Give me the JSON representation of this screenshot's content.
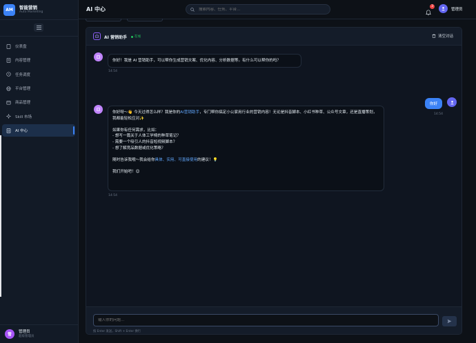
{
  "brand": {
    "logo": "AM",
    "name": "智能营销",
    "subtitle": "Auto Marketing"
  },
  "sidebar": {
    "items": [
      {
        "label": "仪表盘",
        "icon": "file-icon"
      },
      {
        "label": "内容管理",
        "icon": "document-icon"
      },
      {
        "label": "任务调度",
        "icon": "clock-icon"
      },
      {
        "label": "平台管理",
        "icon": "globe-icon"
      },
      {
        "label": "商品管理",
        "icon": "box-icon"
      },
      {
        "label": "Skill 市场",
        "icon": "sparkle-icon"
      },
      {
        "label": "AI 中心",
        "icon": "robot-icon",
        "active": true
      }
    ],
    "footer": {
      "avatar": "管",
      "name": "管理员",
      "role": "超级管理员"
    }
  },
  "header": {
    "title": "AI 中心",
    "search_placeholder": "搜索内容、任务、平台...",
    "notification_count": "3",
    "user_name": "管理员"
  },
  "chat": {
    "title": "AI 营销助手",
    "status": "在线",
    "clear_label": "清空对话",
    "messages": [
      {
        "role": "bot",
        "text": "你好！我是 AI 营销助手，可以帮你生成营销文案、优化内容、分析数据等。有什么可以帮你的吗？",
        "time": "14:54"
      },
      {
        "role": "user",
        "text": "你好",
        "time": "14:54"
      },
      {
        "role": "bot",
        "time": "14:54",
        "p1_a": "你好呀～👋 今天过得怎么样？我是你的",
        "p1_hl": "AI营销助手",
        "p1_b": "，专门帮你搞定小公家用行业的营销内容！无论是抖音脚本、小红书种草、公众号文章，还是直播策划，我都能轻松应对✨",
        "p2_l1": "如果你有任何需求，比如：",
        "p2_l2": "- 想写一篇关于人体工学椅的种草笔记？",
        "p2_l3": "- 需要一个吸引人的抖音短视频脚本？",
        "p2_l4": "- 想了解竞品数据或优化策略？",
        "p3_a": "随时告诉我哦～我会给你",
        "p3_hl": "具体、实用、可直接使用",
        "p3_b": "的建议！💡",
        "p4": "我们开始吧！😊"
      }
    ],
    "input_placeholder": "输入你的问题...",
    "hint": "按 Enter 发送，Shift + Enter 换行"
  },
  "colors": {
    "accent": "#3b82f6",
    "bot_avatar": "#c084fc",
    "online": "#22c55e",
    "badge": "#ef4444"
  }
}
